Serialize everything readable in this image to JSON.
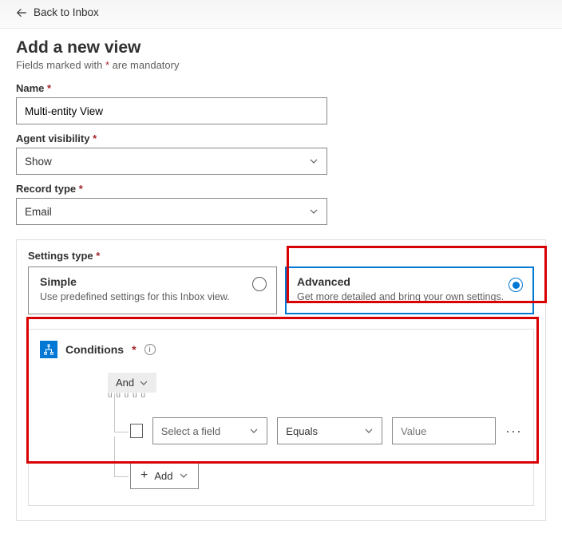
{
  "nav": {
    "back_label": "Back to Inbox"
  },
  "header": {
    "title": "Add a new view",
    "subtitle_prefix": "Fields marked with ",
    "subtitle_suffix": " are mandatory"
  },
  "fields": {
    "name": {
      "label": "Name",
      "value": "Multi-entity View"
    },
    "agent_visibility": {
      "label": "Agent visibility",
      "value": "Show"
    },
    "record_type": {
      "label": "Record type",
      "value": "Email"
    }
  },
  "settings_type": {
    "label": "Settings type",
    "options": [
      {
        "title": "Simple",
        "desc": "Use predefined settings for this Inbox view.",
        "selected": false
      },
      {
        "title": "Advanced",
        "desc": "Get more detailed and bring your own settings.",
        "selected": true
      }
    ]
  },
  "conditions": {
    "label": "Conditions",
    "group_operator": "And",
    "row": {
      "field_placeholder": "Select a field",
      "operator": "Equals",
      "value_placeholder": "Value"
    },
    "add_label": "Add"
  }
}
